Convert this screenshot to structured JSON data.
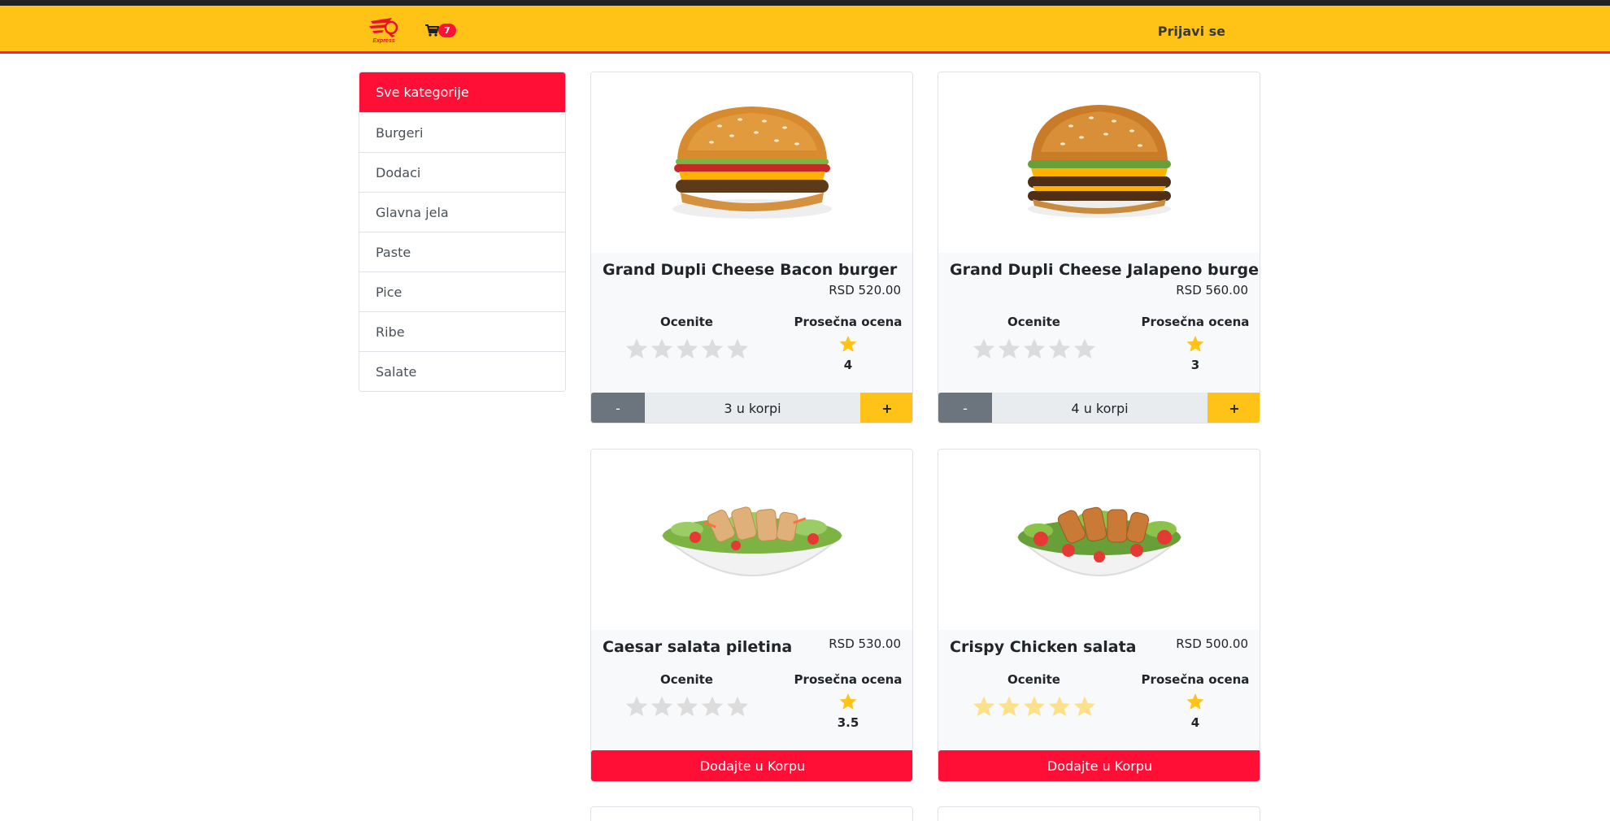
{
  "nav": {
    "logo_text": "Food Express",
    "cart_count": "7",
    "login_label": "Prijavi se",
    "brand_color": "#ffc216",
    "accent_color": "#ff0f35"
  },
  "categories": [
    {
      "label": "Sve kategorije",
      "active": true
    },
    {
      "label": "Burgeri"
    },
    {
      "label": "Dodaci"
    },
    {
      "label": "Glavna jela"
    },
    {
      "label": "Paste"
    },
    {
      "label": "Pice"
    },
    {
      "label": "Ribe"
    },
    {
      "label": "Salate"
    }
  ],
  "labels": {
    "rate": "Ocenite",
    "average": "Prosečna ocena",
    "add_to_cart": "Dodajte u Korpu",
    "minus": "-",
    "plus": "+"
  },
  "products": [
    {
      "name": "Grand Dupli Cheese Bacon burger",
      "price": "RSD 520.00",
      "avg_rating": "4",
      "user_rating": 0,
      "in_cart": "3 u korpi",
      "image": "burger-bacon"
    },
    {
      "name": "Grand Dupli Cheese Jalapeno burger",
      "price": "RSD 560.00",
      "avg_rating": "3",
      "user_rating": 0,
      "in_cart": "4 u korpi",
      "image": "burger-jalapeno"
    },
    {
      "name": "Caesar salata piletina",
      "price": "RSD 530.00",
      "avg_rating": "3.5",
      "user_rating": 0,
      "in_cart": null,
      "image": "caesar-salad"
    },
    {
      "name": "Crispy Chicken salata",
      "price": "RSD 500.00",
      "avg_rating": "4",
      "user_rating": 5,
      "in_cart": null,
      "image": "crispy-chicken-salad"
    }
  ]
}
